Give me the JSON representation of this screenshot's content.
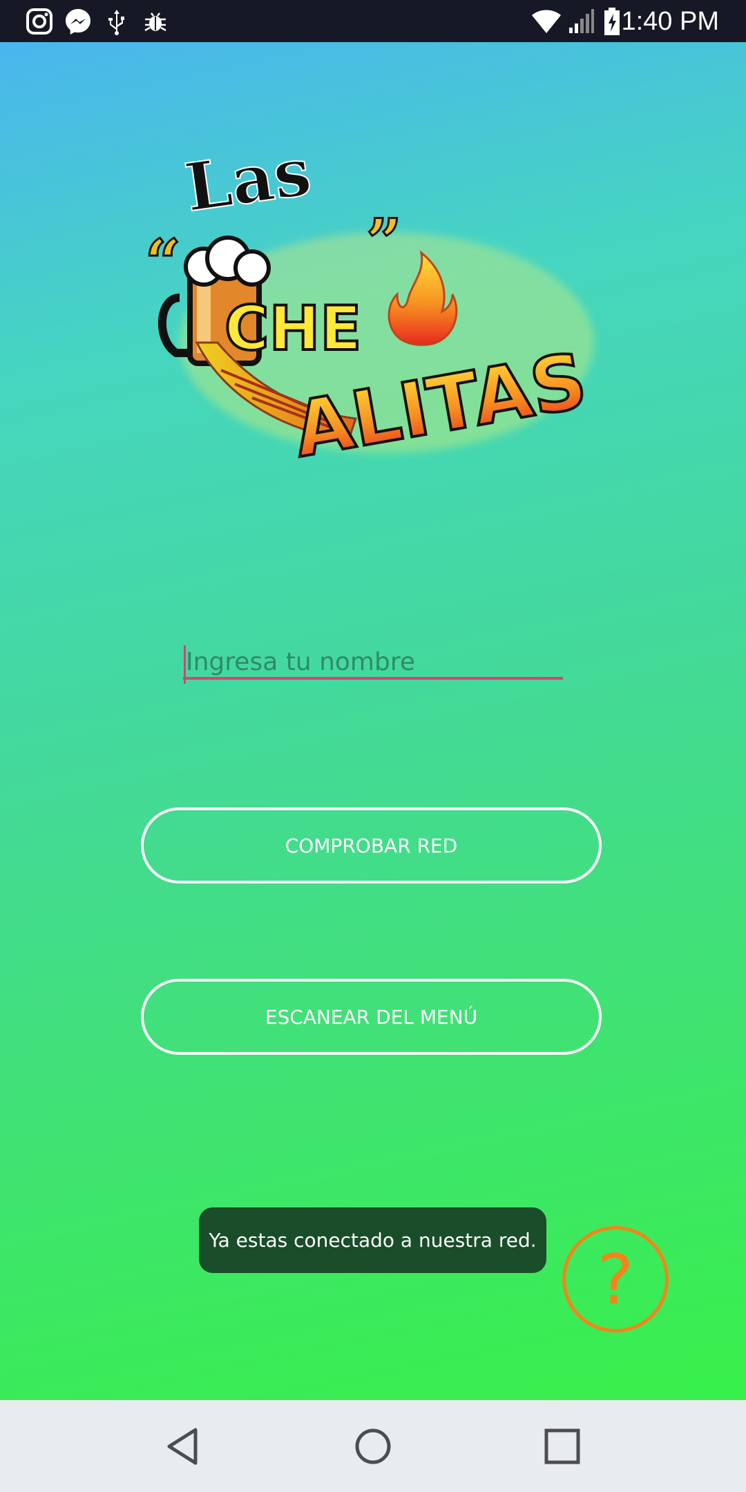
{
  "status_bar": {
    "time": "1:40 PM",
    "left_icons": [
      "instagram-icon",
      "messenger-icon",
      "usb-icon",
      "bug-icon"
    ],
    "right_icons": [
      "wifi-icon",
      "signal-icon",
      "battery-charging-icon"
    ]
  },
  "logo": {
    "line1": "Las",
    "line2": "\"CHE\"",
    "line3": "ALITAS"
  },
  "form": {
    "name_placeholder": "Ingresa tu nombre",
    "name_value": ""
  },
  "buttons": {
    "check_network": "COMPROBAR RED",
    "scan_menu": "ESCANEAR DEL MENÚ"
  },
  "toast": {
    "message": "Ya estas conectado a nuestra red."
  },
  "help_button": {
    "glyph": "?"
  },
  "nav_bar": {
    "icons": [
      "back-icon",
      "home-icon",
      "recents-icon"
    ]
  },
  "colors": {
    "accent": "#e23d77",
    "help": "#f68319",
    "toast_bg": "#1a4d2a",
    "status_bar_bg": "#161925"
  }
}
